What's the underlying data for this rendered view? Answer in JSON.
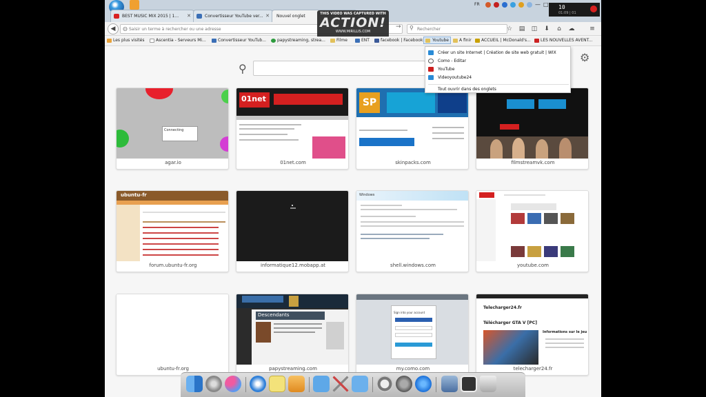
{
  "tabs": [
    {
      "label": "BEST MUSIC MIX 2015 | 1...",
      "icon": "youtube-icon"
    },
    {
      "label": "Convertisseur YouTube ver...",
      "icon": "page-icon"
    },
    {
      "label": "Nouvel onglet",
      "icon": "none"
    }
  ],
  "tabbar": {
    "new_tab": "+",
    "lang": "FR",
    "minimize": "—",
    "maximize": "□",
    "close": "✕"
  },
  "clock": {
    "time": "10",
    "date": "01:09 | 01"
  },
  "watermark": {
    "line1": "THIS VIDEO WAS CAPTURED WITH",
    "line2": "ACTION!",
    "line3": "WWW.MIRILLIS.COM"
  },
  "navbar": {
    "url_placeholder": "Saisir un terme à rechercher ou une adresse",
    "search_placeholder": "Rechercher"
  },
  "bookmarks": [
    {
      "label": "Les plus visités",
      "color": "#e8a23a"
    },
    {
      "label": "Ascentia - Serveurs Mi...",
      "color": "#ffffff"
    },
    {
      "label": "Convertisseur YouTub...",
      "color": "#3b6fb6"
    },
    {
      "label": "papystreaming, strea...",
      "color": "#2e9b3e"
    },
    {
      "label": "Filme",
      "color": "#e2c15a"
    },
    {
      "label": "ENT",
      "color": "#3b6fb6"
    },
    {
      "label": "facebook | Facebook",
      "color": "#3b5998"
    },
    {
      "label": "Youtube",
      "color": "#e2c15a"
    },
    {
      "label": "A finir",
      "color": "#e2c15a"
    },
    {
      "label": "ACCUEIL | McDonald's...",
      "color": "#c8a000"
    },
    {
      "label": "LES NOUVELLES AVENT...",
      "color": "#cc2222"
    }
  ],
  "dropdown": [
    {
      "label": "Créer un site Internet | Création de site web gratuit | WIX",
      "color": "#2a8bd6"
    },
    {
      "label": "Como - Editar",
      "color": "#555555"
    },
    {
      "label": "YouTube",
      "color": "#cc1f1f"
    },
    {
      "label": "Videoyoutube24",
      "color": "#2a8bd6"
    },
    {
      "label": "Tout ouvrir dans des onglets",
      "color": "none"
    }
  ],
  "tiles": [
    {
      "label": "agar.io"
    },
    {
      "label": "01net.com"
    },
    {
      "label": "skinpacks.com"
    },
    {
      "label": "filmstreamvk.com"
    },
    {
      "label": "forum.ubuntu-fr.org"
    },
    {
      "label": "informatique12.mobapp.at"
    },
    {
      "label": "shell.windows.com"
    },
    {
      "label": "youtube.com"
    },
    {
      "label": "ubuntu-fr.org"
    },
    {
      "label": "papystreaming.com"
    },
    {
      "label": "my.como.com"
    },
    {
      "label": "telecharger24.fr"
    }
  ],
  "thumb_text": {
    "agar_dialog": "Connecting",
    "net_logo": "01net",
    "sp_logo": "SP",
    "gta_title": "Télécharger GTA V [PC]",
    "gta_info": "Informations sur le jeu",
    "como_title": "Sign into your account",
    "papy_title": "Descendants",
    "ubuntu_logo": "ubuntu-fr",
    "tele_logo": "Telecharger24.fr",
    "shell_logo": "Windows"
  },
  "dock": [
    {
      "name": "finder-icon",
      "color": "#3b8fe0"
    },
    {
      "name": "system-preferences-icon",
      "color": "#8a8a8a"
    },
    {
      "name": "game-center-icon",
      "color": "#e86aa8"
    },
    {
      "name": "safari-icon",
      "color": "#2e7fd8"
    },
    {
      "name": "notes-icon",
      "color": "#f3e27a"
    },
    {
      "name": "media-player-icon",
      "color": "#f0a030"
    },
    {
      "name": "folder-icon",
      "color": "#5ea8e8"
    },
    {
      "name": "tools-icon",
      "color": "#c44"
    },
    {
      "name": "applications-folder-icon",
      "color": "#6bb0ec"
    },
    {
      "name": "power-icon",
      "color": "#777"
    },
    {
      "name": "launchpad-icon",
      "color": "#777"
    },
    {
      "name": "app-store-icon",
      "color": "#2f8ae5"
    },
    {
      "name": "image-viewer-icon",
      "color": "#4a6ea0"
    },
    {
      "name": "window-switcher-icon",
      "color": "#333"
    },
    {
      "name": "trash-icon",
      "color": "#bbb"
    }
  ]
}
